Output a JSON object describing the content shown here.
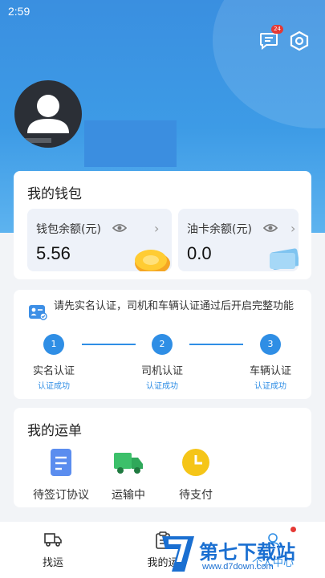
{
  "status_bar": {
    "time": "2:59"
  },
  "header": {
    "message_badge": "24"
  },
  "wallet": {
    "title": "我的钱包",
    "balance_label": "钱包余额(元)",
    "balance_value": "5.56",
    "fuel_label": "油卡余额(元)",
    "fuel_value": "0.0"
  },
  "verification": {
    "notice": "请先实名认证，司机和车辆认证通过后开启完整功能",
    "steps": [
      {
        "number": "1",
        "label": "实名认证",
        "status": "认证成功"
      },
      {
        "number": "2",
        "label": "司机认证",
        "status": "认证成功"
      },
      {
        "number": "3",
        "label": "车辆认证",
        "status": "认证成功"
      }
    ]
  },
  "orders": {
    "title": "我的运单",
    "items": [
      {
        "label": "待签订协议",
        "icon": "document-icon",
        "color": "#5b8def"
      },
      {
        "label": "运输中",
        "icon": "truck-icon",
        "color": "#3cc06a"
      },
      {
        "label": "待支付",
        "icon": "clock-icon",
        "color": "#f5c518"
      }
    ]
  },
  "tabbar": {
    "tabs": [
      {
        "label": "找运",
        "icon": "truck-outline-icon"
      },
      {
        "label": "我的运",
        "icon": "clipboard-icon"
      },
      {
        "label": "个人中心",
        "icon": "person-icon"
      }
    ]
  },
  "watermark": {
    "brand": "第七下载站",
    "url": "www.d7down.com"
  },
  "colors": {
    "primary": "#2f8ee5",
    "hero": "#3d9be6",
    "badge": "#e53935"
  }
}
